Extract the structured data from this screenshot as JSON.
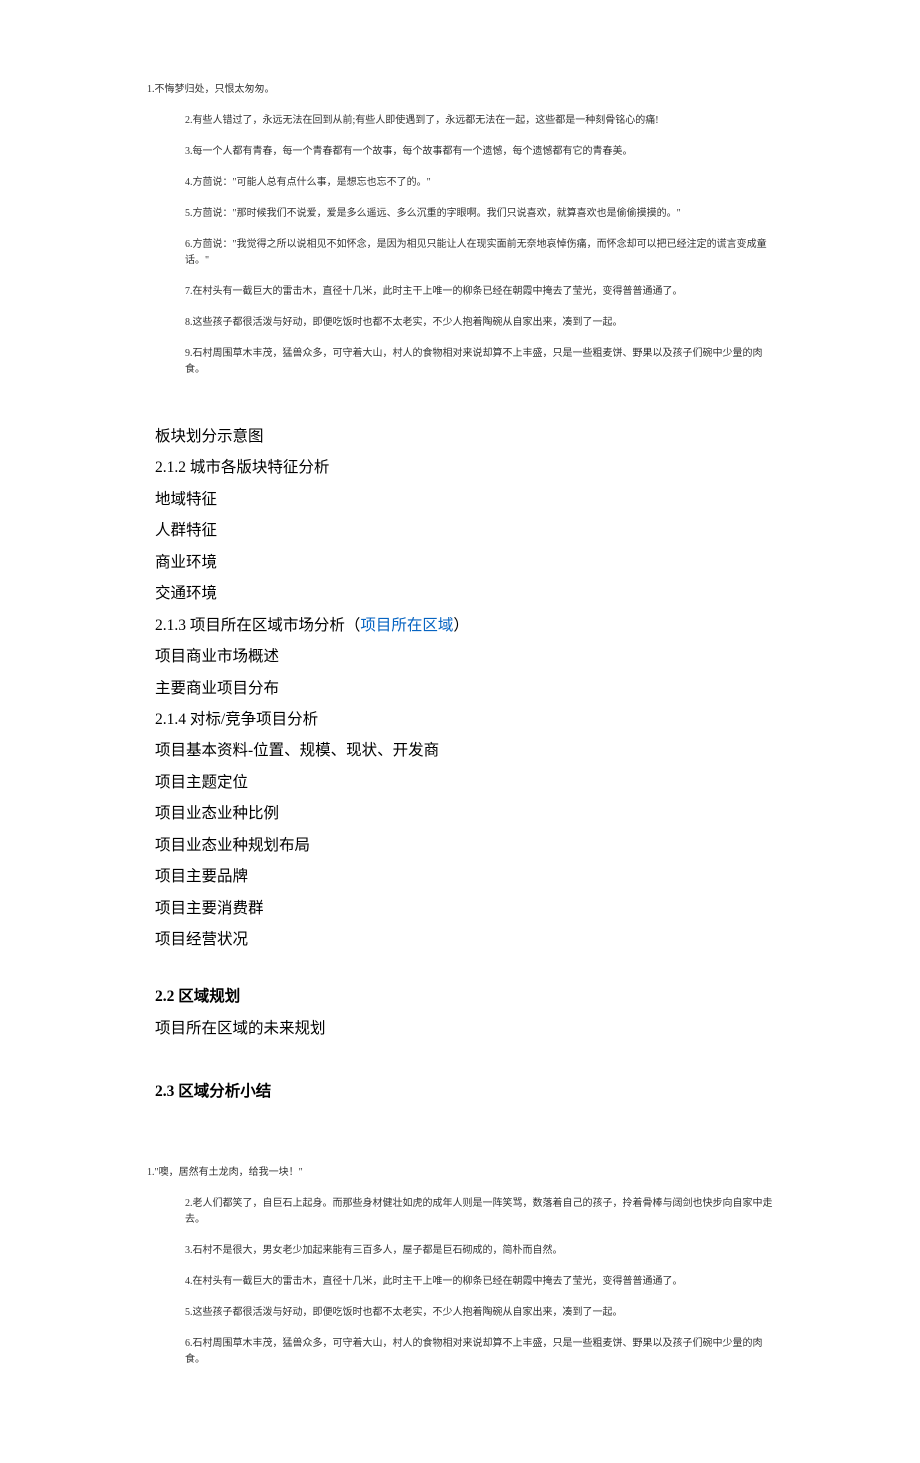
{
  "top_quotes": [
    "1.不悔梦归处，只恨太匆匆。",
    "2.有些人错过了，永远无法在回到从前;有些人即使遇到了，永远都无法在一起，这些都是一种刻骨铭心的痛!",
    "3.每一个人都有青春，每一个青春都有一个故事，每个故事都有一个遗憾，每个遗憾都有它的青春美。",
    "4.方茴说：\"可能人总有点什么事，是想忘也忘不了的。\"",
    "5.方茴说：\"那时候我们不说爱，爱是多么遥远、多么沉重的字眼啊。我们只说喜欢，就算喜欢也是偷偷摸摸的。\"",
    "6.方茴说：\"我觉得之所以说相见不如怀念，是因为相见只能让人在现实面前无奈地哀悼伤痛，而怀念却可以把已经注定的谎言变成童话。\"",
    "7.在村头有一截巨大的雷击木，直径十几米，此时主干上唯一的柳条已经在朝霞中掩去了莹光，变得普普通通了。",
    "8.这些孩子都很活泼与好动，即便吃饭时也都不太老实，不少人抱着陶碗从自家出来，凑到了一起。",
    "9.石村周围草木丰茂，猛兽众多，可守着大山，村人的食物相对来说却算不上丰盛，只是一些粗麦饼、野果以及孩子们碗中少量的肉食。"
  ],
  "body": {
    "l1": "板块划分示意图",
    "h212": "2.1.2 城市各版块特征分析",
    "l2": "地域特征",
    "l3": "人群特征",
    "l4": "商业环境",
    "l5": "交通环境",
    "h213_pre": "2.1.3 项目所在区域市场分析（",
    "h213_link": "项目所在区域",
    "h213_post": "）",
    "l6": "项目商业市场概述",
    "l7": "主要商业项目分布",
    "h214": "2.1.4 对标/竞争项目分析",
    "l8": "项目基本资料-位置、规模、现状、开发商",
    "l9": "项目主题定位",
    "l10": "项目业态业种比例",
    "l11": "项目业态业种规划布局",
    "l12": "项目主要品牌",
    "l13": "项目主要消费群",
    "l14": "项目经营状况",
    "h22": "2.2 区域规划",
    "l15": "项目所在区域的未来规划",
    "h23": "2.3 区域分析小结"
  },
  "bottom_quotes": [
    "1.\"噢，居然有土龙肉，给我一块！\"",
    "2.老人们都笑了，自巨石上起身。而那些身材健壮如虎的成年人则是一阵笑骂，数落着自己的孩子，拎着骨棒与阔剑也快步向自家中走去。",
    "3.石村不是很大，男女老少加起来能有三百多人，屋子都是巨石砌成的，简朴而自然。",
    "4.在村头有一截巨大的雷击木，直径十几米，此时主干上唯一的柳条已经在朝霞中掩去了莹光，变得普普通通了。",
    "5.这些孩子都很活泼与好动，即便吃饭时也都不太老实，不少人抱着陶碗从自家出来，凑到了一起。",
    "6.石村周围草木丰茂，猛兽众多，可守着大山，村人的食物相对来说却算不上丰盛，只是一些粗麦饼、野果以及孩子们碗中少量的肉食。"
  ]
}
